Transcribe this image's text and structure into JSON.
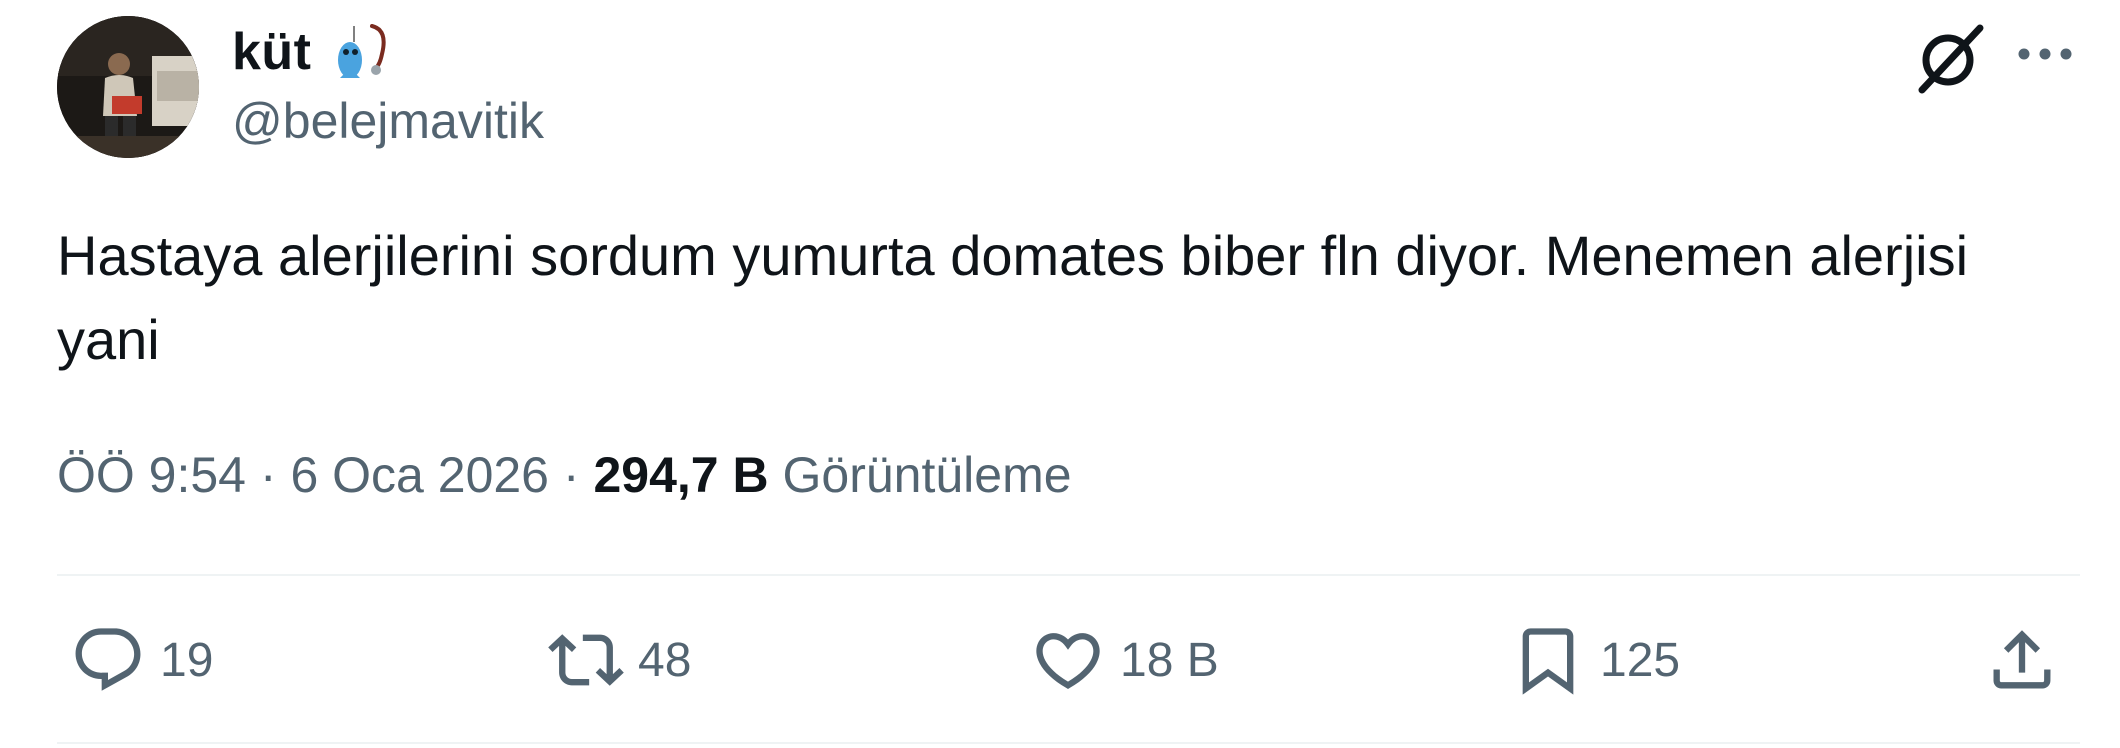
{
  "author": {
    "display_name": "küt",
    "name_emoji": "fishing-pole-fish-emoji",
    "handle": "@belejmavitik",
    "avatar": "user-avatar-photo"
  },
  "header_actions": {
    "grok_icon": "grok-icon",
    "more_icon": "more-horizontal-icon"
  },
  "tweet": {
    "text": "Hastaya alerjilerini sordum yumurta domates biber fln diyor. Menemen alerjisi yani"
  },
  "meta": {
    "time": "ÖÖ 9:54",
    "separator": "·",
    "date": "6 Oca 2026",
    "views_count": "294,7 B",
    "views_label": "Görüntüleme"
  },
  "actions": {
    "reply": {
      "icon": "reply-icon",
      "count": "19"
    },
    "retweet": {
      "icon": "retweet-icon",
      "count": "48"
    },
    "like": {
      "icon": "heart-icon",
      "count": "18 B"
    },
    "bookmark": {
      "icon": "bookmark-icon",
      "count": "125"
    },
    "share": {
      "icon": "share-icon"
    }
  },
  "colors": {
    "text_primary": "#0f1419",
    "text_secondary": "#536471",
    "divider": "#eff3f4",
    "background": "#ffffff"
  }
}
